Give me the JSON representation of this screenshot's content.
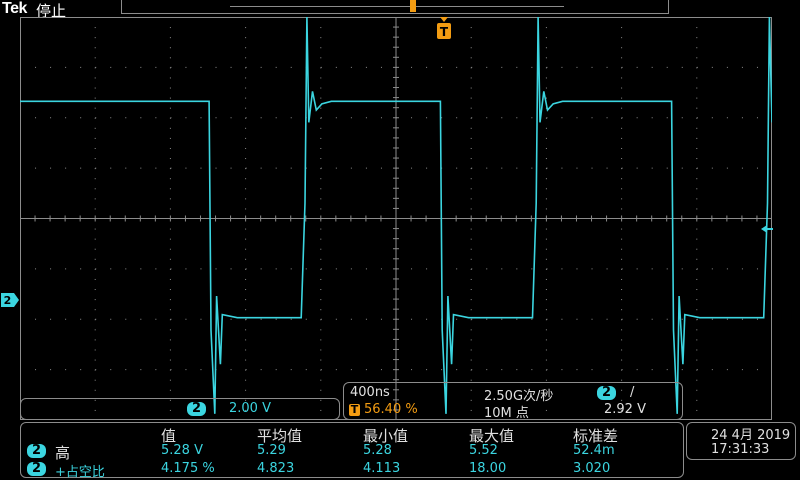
{
  "top_bar": {
    "brand": "Tek",
    "run_state": "停止"
  },
  "markers": {
    "trigger_position_label": "T",
    "channel_ground_label": "2"
  },
  "channel_scale": {
    "channel": "2",
    "value": "2.00 V"
  },
  "horizontal": {
    "time_per_div": "400ns",
    "sample_rate": "2.50G次/秒",
    "trigger_source": "2",
    "trigger_slope_symbol": "/",
    "trigger_icon": "T",
    "trigger_position": "56.40 %",
    "record_length": "10M 点",
    "trigger_level": "2.92 V"
  },
  "measurements": {
    "headers": [
      "值",
      "平均值",
      "最小值",
      "最大值",
      "标准差"
    ],
    "rows": [
      {
        "channel": "2",
        "name": "高",
        "values": [
          "5.28 V",
          "5.29",
          "5.28",
          "5.52",
          "52.4m"
        ]
      },
      {
        "channel": "2",
        "name": "+占空比",
        "values": [
          "4.175 %",
          "4.823",
          "4.113",
          "18.00",
          "3.020"
        ]
      }
    ]
  },
  "datetime": {
    "date": "24 4月 2019",
    "time": "17:31:33"
  },
  "colors": {
    "trace": "#3bd5e0",
    "trigger": "#f39c12",
    "grid": "#8c8c8c"
  },
  "chart_data": {
    "type": "line",
    "title": "",
    "xlabel": "",
    "ylabel": "",
    "x_unit": "s",
    "y_unit": "V",
    "x_div": "400ns",
    "y_div": "2.00 V",
    "xlim": [
      -2.256e-06,
      1.744e-06
    ],
    "ylim": [
      -5.0,
      8.0
    ],
    "grid": true,
    "series": [
      {
        "x": [
          -2.256e-06,
          -1.25e-06,
          -1.24e-06,
          -1.22e-06,
          -1.21e-06,
          -1.19e-06,
          -1.18e-06,
          -1.1e-06,
          -1e-06,
          -8e-07,
          -7.6e-07,
          -7.4e-07,
          -7.3e-07,
          -7.2e-07,
          -7e-07,
          -6.8e-07,
          -6.5e-07,
          -6e-07,
          -5e-07,
          -2e-08,
          -1e-08,
          1e-08,
          2e-08,
          4e-08,
          5e-08,
          1.3e-07,
          2.3e-07,
          4.3e-07,
          4.7e-07,
          4.9e-07,
          5e-07,
          5.1e-07,
          5.3e-07,
          5.5e-07,
          5.8e-07,
          6.3e-07,
          7.3e-07,
          1.21e-06,
          1.22e-06,
          1.24e-06,
          1.25e-06,
          1.27e-06,
          1.28e-06,
          1.36e-06,
          1.46e-06,
          1.66e-06,
          1.7e-06,
          1.72e-06,
          1.73e-06,
          1.744e-06
        ],
        "values": [
          5.28,
          5.28,
          -2.1,
          -4.8,
          -1.0,
          -3.2,
          -1.6,
          -1.7,
          -1.7,
          -1.7,
          -1.7,
          2.0,
          8.0,
          4.6,
          5.6,
          5.0,
          5.2,
          5.28,
          5.28,
          5.28,
          -2.1,
          -4.8,
          -1.0,
          -3.2,
          -1.6,
          -1.7,
          -1.7,
          -1.7,
          -1.7,
          2.0,
          8.0,
          4.6,
          5.6,
          5.0,
          5.2,
          5.28,
          5.28,
          5.28,
          -2.1,
          -4.8,
          -1.0,
          -3.2,
          -1.6,
          -1.7,
          -1.7,
          -1.7,
          -1.7,
          2.0,
          8.0,
          4.6
        ]
      }
    ]
  }
}
